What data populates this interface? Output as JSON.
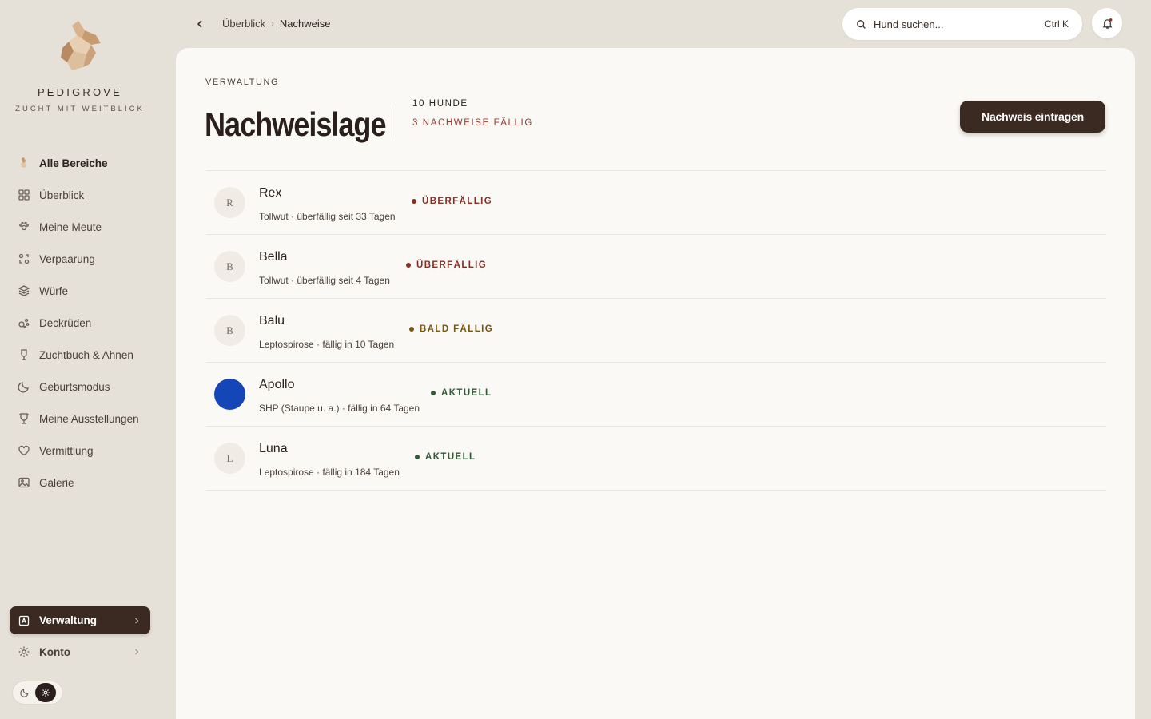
{
  "brand": {
    "name": "PEDIGROVE",
    "tagline": "ZUCHT MIT WEITBLICK"
  },
  "sidebar": {
    "items": [
      {
        "label": "Alle Bereiche",
        "icon": "dog-icon"
      },
      {
        "label": "Überblick",
        "icon": "grid-icon"
      },
      {
        "label": "Meine Meute",
        "icon": "paw-icon"
      },
      {
        "label": "Verpaarung",
        "icon": "pairing-icon"
      },
      {
        "label": "Würfe",
        "icon": "layers-icon"
      },
      {
        "label": "Deckrüden",
        "icon": "dots-icon"
      },
      {
        "label": "Zuchtbuch & Ahnen",
        "icon": "tree-icon"
      },
      {
        "label": "Geburtsmodus",
        "icon": "moon-icon"
      },
      {
        "label": "Meine Ausstellungen",
        "icon": "trophy-icon"
      },
      {
        "label": "Vermittlung",
        "icon": "heart-icon"
      },
      {
        "label": "Galerie",
        "icon": "image-icon"
      }
    ],
    "admin": "Verwaltung",
    "account": "Konto"
  },
  "topbar": {
    "breadcrumb": [
      "Überblick",
      "Nachweise"
    ],
    "search_placeholder": "Hund suchen...",
    "shortcut": "Ctrl K"
  },
  "page": {
    "section": "VERWALTUNG",
    "title": "Nachweislage",
    "stat_dogs": "10 HUNDE",
    "stat_due": "3 NACHWEISE FÄLLIG",
    "primary_action": "Nachweis eintragen"
  },
  "dogs": [
    {
      "initial": "R",
      "name": "Rex",
      "detail": "Tollwut · überfällig seit 33 Tagen",
      "status": "ÜBERFÄLLIG",
      "status_color": "#8a2e24"
    },
    {
      "initial": "B",
      "name": "Bella",
      "detail": "Tollwut · überfällig seit 4 Tagen",
      "status": "ÜBERFÄLLIG",
      "status_color": "#8a2e24"
    },
    {
      "initial": "B",
      "name": "Balu",
      "detail": "Leptospirose · fällig in 10 Tagen",
      "status": "BALD FÄLLIG",
      "status_color": "#7a5610"
    },
    {
      "initial": "",
      "name": "Apollo",
      "detail": "SHP (Staupe u. a.) · fällig in 64 Tagen",
      "status": "AKTUELL",
      "status_color": "#2f5a36"
    },
    {
      "initial": "L",
      "name": "Luna",
      "detail": "Leptospirose · fällig in 184 Tagen",
      "status": "AKTUELL",
      "status_color": "#2f5a36"
    }
  ],
  "colors": {
    "accent": "#3b2a22",
    "overdue": "#8a2e24",
    "due_soon": "#7a5610",
    "current": "#2f5a36",
    "avatar_photo": "#1446b8"
  }
}
